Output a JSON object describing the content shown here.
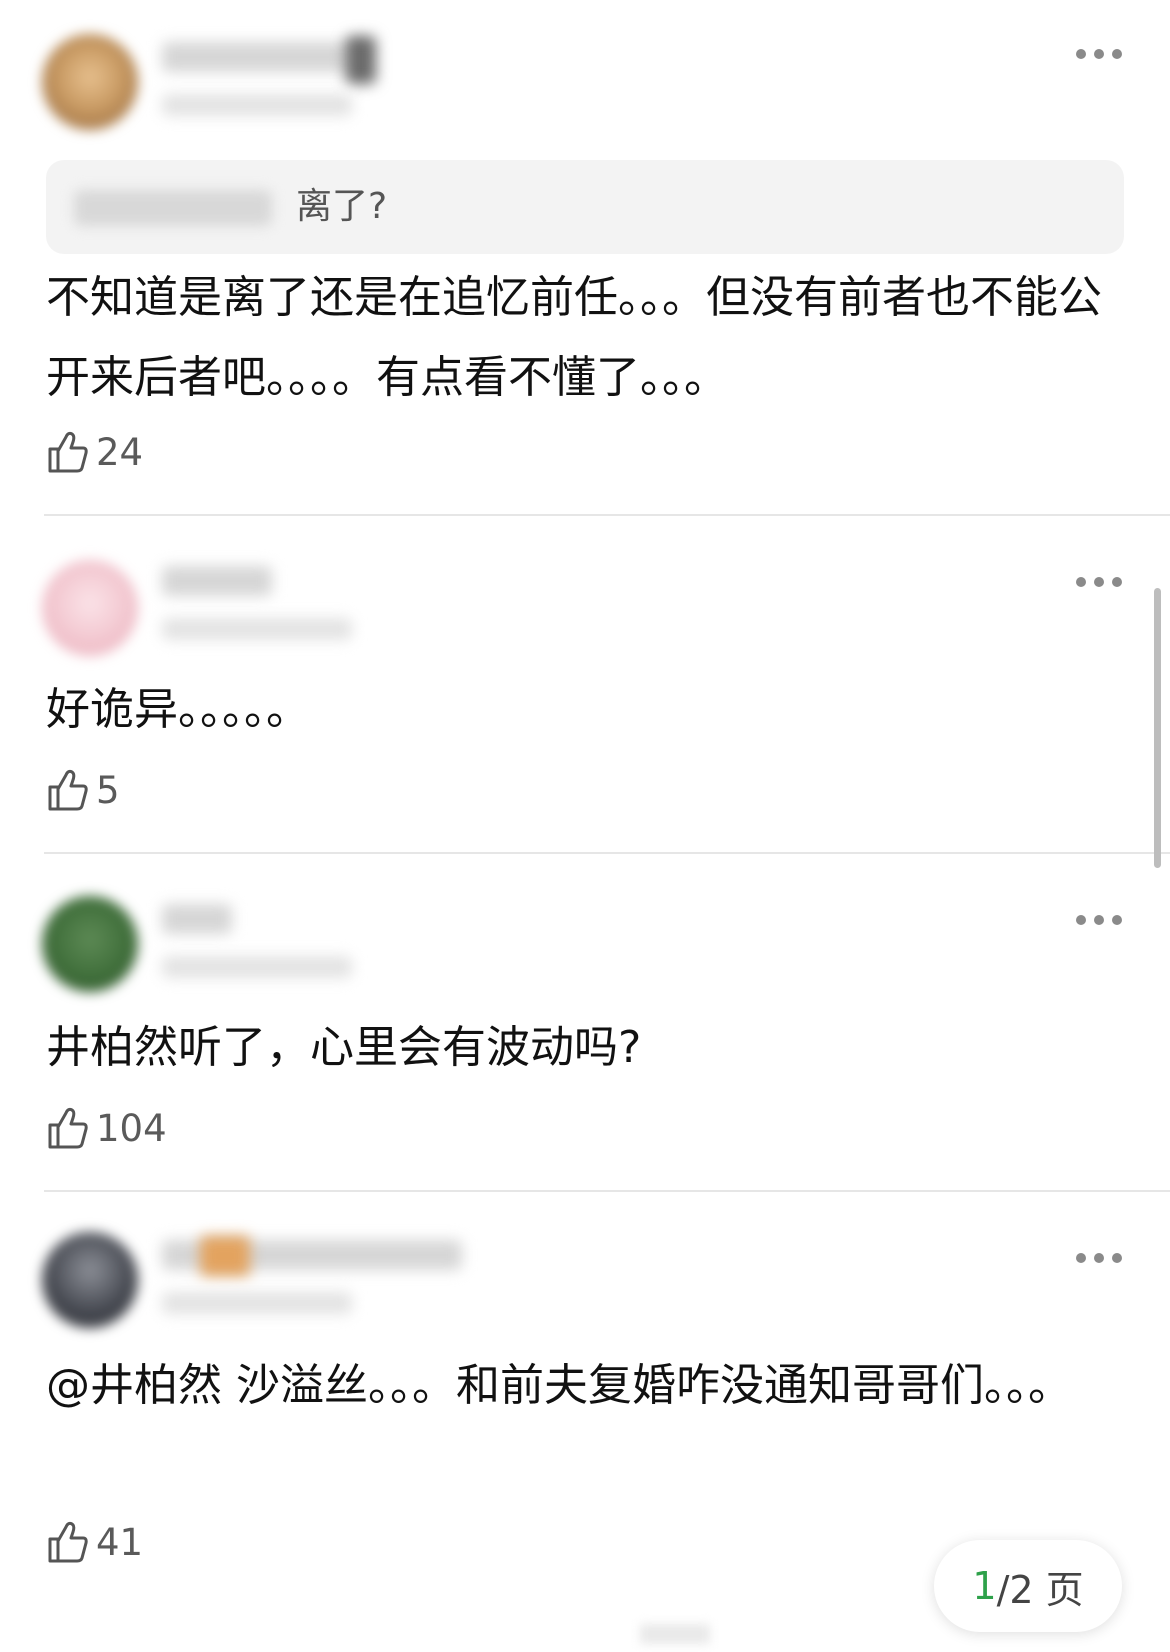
{
  "comments": [
    {
      "quote_text": "离了?",
      "text": "不知道是离了还是在追忆前任。。。但没有前者也不能公开来后者吧。。。。有点看不懂了。。。",
      "likes": "24",
      "avatar_color": "#c89a63"
    },
    {
      "text": "好诡异。。。。。",
      "likes": "5",
      "avatar_color": "#f2c6cf"
    },
    {
      "text": "井柏然听了，心里会有波动吗?",
      "likes": "104",
      "avatar_color": "#3f6e3a"
    },
    {
      "text": "@井柏然 沙溢丝。。。和前夫复婚咋没通知哥哥们。。。",
      "likes": "41",
      "avatar_color": "#474a52"
    }
  ],
  "pager": {
    "current": "1",
    "rest": "/2 页"
  },
  "icons": {
    "like": "thumbs-up-icon",
    "more": "more-dots-icon"
  },
  "colors": {
    "accent": "#2ea14a",
    "divider": "#e6e6e6",
    "quote_bg": "#f3f3f3"
  }
}
